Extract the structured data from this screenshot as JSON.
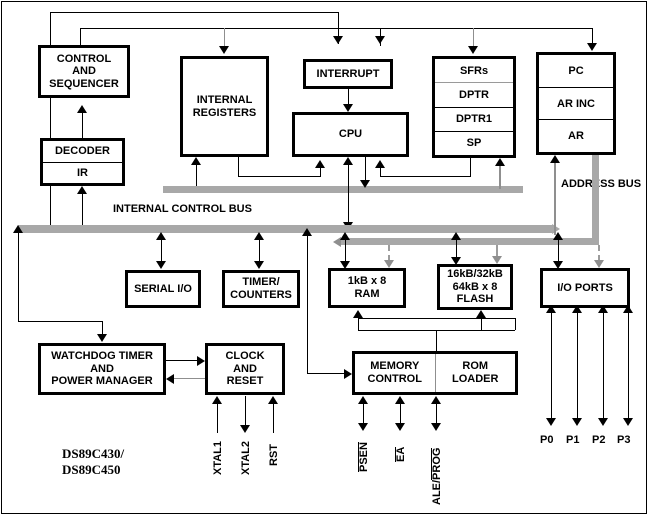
{
  "diagram": {
    "part_number_line1": "DS89C430/",
    "part_number_line2": "DS89C450",
    "bus_labels": {
      "internal_control_bus": "INTERNAL CONTROL BUS",
      "address_bus": "ADDRESS BUS"
    },
    "blocks": {
      "control_sequencer": "CONTROL\nAND\nSEQUENCER",
      "control_sequencer_l1": "CONTROL",
      "control_sequencer_l2": "AND",
      "control_sequencer_l3": "SEQUENCER",
      "decoder": "DECODER",
      "ir": "IR",
      "internal_registers_l1": "INTERNAL",
      "internal_registers_l2": "REGISTERS",
      "interrupt": "INTERRUPT",
      "cpu": "CPU",
      "sfrs": "SFRs",
      "dptr": "DPTR",
      "dptr1": "DPTR1",
      "sp": "SP",
      "pc": "PC",
      "ar_inc": "AR INC",
      "ar": "AR",
      "serial_io": "SERIAL I/O",
      "timer_counters_l1": "TIMER/",
      "timer_counters_l2": "COUNTERS",
      "ram_l1": "1kB x 8",
      "ram_l2": "RAM",
      "flash_l1": "16kB/32kB",
      "flash_l2": "64kB x 8",
      "flash_l3": "FLASH",
      "io_ports": "I/O PORTS",
      "watchdog_l1": "WATCHDOG TIMER",
      "watchdog_l2": "AND",
      "watchdog_l3": "POWER MANAGER",
      "clock_reset_l1": "CLOCK",
      "clock_reset_l2": "AND",
      "clock_reset_l3": "RESET",
      "memory_control_l1": "MEMORY",
      "memory_control_l2": "CONTROL",
      "rom_loader_l1": "ROM",
      "rom_loader_l2": "LOADER"
    },
    "pins": {
      "xtal1": "XTAL1",
      "xtal2": "XTAL2",
      "rst": "RST",
      "psen": "PSEN",
      "ea": "EA",
      "ale": "ALE/",
      "prog": "PROG",
      "p0": "P0",
      "p1": "P1",
      "p2": "P2",
      "p3": "P3"
    },
    "colors": {
      "line": "#000000",
      "bus": "#a8a8a8",
      "gray_line": "#8f8f8f",
      "background": "#ffffff"
    }
  }
}
